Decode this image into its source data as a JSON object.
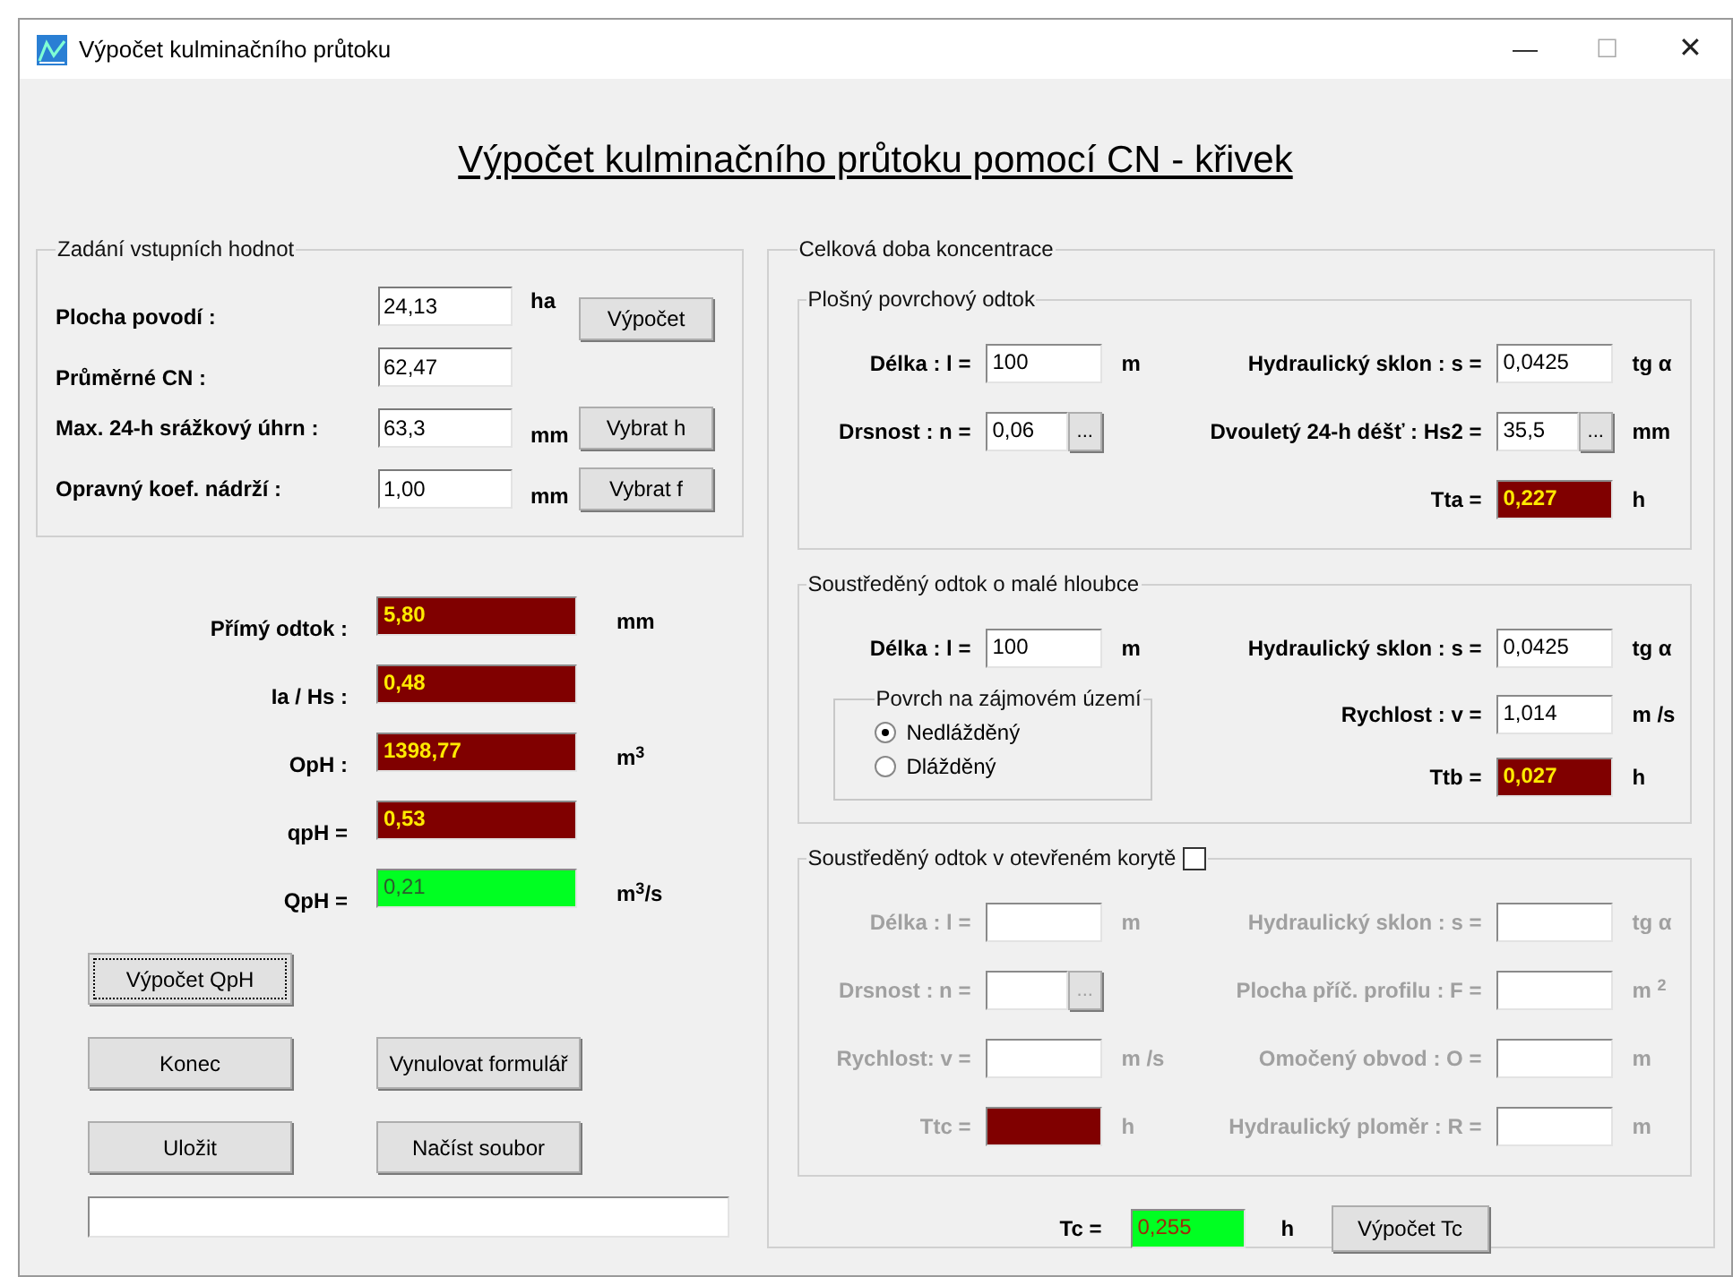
{
  "window": {
    "title": "Výpočet kulminačního průtoku",
    "controls": [
      "—",
      "☐",
      "✕"
    ]
  },
  "heading": "Výpočet kulminačního průtoku pomocí CN - křivek",
  "inputs_group": {
    "title": "Zadání vstupních hodnot",
    "rows": [
      {
        "label": "Plocha povodí :",
        "value": "24,13",
        "unit": "ha",
        "button": "Výpočet"
      },
      {
        "label": "Průměrné CN :",
        "value": "62,47"
      },
      {
        "label": "Max. 24-h srážkový úhrn :",
        "value": "63,3",
        "unit": "mm",
        "button": "Vybrat h"
      },
      {
        "label": "Opravný koef. nádrží :",
        "value": "1,00",
        "unit": "mm",
        "button": "Vybrat f"
      }
    ]
  },
  "results": [
    {
      "label": "Přímý odtok :",
      "value": "5,80",
      "unit": "mm",
      "kind": "result"
    },
    {
      "label": "Ia / Hs :",
      "value": "0,48",
      "kind": "result"
    },
    {
      "label": "OpH :",
      "value": "1398,77",
      "unit": "m$^{3}$",
      "kind": "result"
    },
    {
      "label": "qpH =",
      "value": "0,53",
      "kind": "result"
    },
    {
      "label": "QpH =",
      "value": "0,21",
      "unit": "m$^{3}$/s",
      "kind": "total"
    }
  ],
  "buttons": [
    {
      "label": "Výpočet QpH",
      "focused": true
    },
    {
      "label": "Konec",
      "focused": false
    },
    {
      "label": "Vynulovat formulář",
      "focused": false
    },
    {
      "label": "Uložit",
      "focused": false
    },
    {
      "label": "Načíst soubor",
      "focused": false
    }
  ],
  "concentration": {
    "title": "Celková doba koncentrace",
    "sections": [
      {
        "title": "Plošný povrchový odtok",
        "enabled": true,
        "rows": [
          {
            "left": {
              "label": "Délka : l =",
              "value": "100",
              "unit": "m",
              "kind": "input"
            },
            "right": {
              "label": "Hydraulický sklon : s =",
              "value": "0,0425",
              "unit": "tg α",
              "kind": "input"
            }
          },
          {
            "left": {
              "label": "Drsnost : n =",
              "value": "0,06",
              "picker": "...",
              "kind": "input"
            },
            "right": {
              "label": "Dvouletý 24-h déšť : Hs2 =",
              "value": "35,5",
              "picker": "...",
              "unit": "mm",
              "kind": "input"
            }
          },
          {
            "right": {
              "label": "Tta =",
              "value": "0,227",
              "unit": "h",
              "kind": "result"
            }
          }
        ]
      },
      {
        "title": "Soustředěný odtok o malé hloubce",
        "enabled": true,
        "rows": [
          {
            "left": {
              "label": "Délka : l =",
              "value": "100",
              "unit": "m",
              "kind": "input"
            },
            "right": {
              "label": "Hydraulický sklon : s =",
              "value": "0,0425",
              "unit": "tg α",
              "kind": "input"
            }
          }
        ],
        "radio_group": {
          "title": "Povrch na zájmovém území",
          "options": [
            {
              "label": "Nedlážděný",
              "selected": true
            },
            {
              "label": "Dlážděný",
              "selected": false
            }
          ]
        },
        "side_rows": [
          {
            "label": "Rychlost : v =",
            "value": "1,014",
            "unit": "m /s",
            "kind": "input"
          },
          {
            "label": "Ttb =",
            "value": "0,027",
            "unit": "h",
            "kind": "result"
          }
        ]
      },
      {
        "title": "Soustředěný odtok v otevřeném korytě",
        "checkbox": {
          "checked": false
        },
        "enabled": false,
        "rows": [
          {
            "left": {
              "label": "Délka : l =",
              "unit": "m",
              "kind": "input"
            },
            "right": {
              "label": "Hydraulický sklon : s =",
              "unit": "tg α",
              "kind": "input"
            }
          },
          {
            "left": {
              "label": "Drsnost : n =",
              "picker": "...",
              "kind": "input"
            },
            "right": {
              "label": "Plocha příč. profilu : F =",
              "unit": "m $^{2}$",
              "kind": "input"
            }
          },
          {
            "left": {
              "label": "Rychlost: v =",
              "unit": "m /s",
              "kind": "input"
            },
            "right": {
              "label": "Omočený obvod : O =",
              "unit": "m",
              "kind": "input"
            }
          },
          {
            "left": {
              "label": "Ttc =",
              "unit": "h",
              "kind": "result"
            },
            "right": {
              "label": "Hydraulický ploměr : R =",
              "unit": "m",
              "kind": "input"
            }
          }
        ]
      }
    ],
    "total": {
      "label": "Tc =",
      "value": "0,255",
      "unit": "h",
      "kind": "total",
      "button": "Výpočet Tc"
    }
  }
}
